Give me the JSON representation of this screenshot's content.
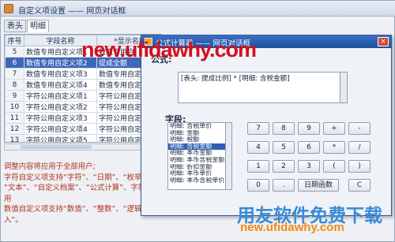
{
  "back_window": {
    "title": "自定义项设置 —— 网页对话框",
    "tabs": [
      "表头",
      "明细"
    ],
    "grid": {
      "headers": [
        "序号",
        "字段名称",
        "*显示名称"
      ],
      "rows": [
        {
          "no": "5",
          "field": "数值专用自定义项1",
          "display": "数值专用自"
        },
        {
          "no": "6",
          "field": "数值专用自定义项2",
          "display": "提成全额"
        },
        {
          "no": "7",
          "field": "数值专用自定义项3",
          "display": "数值专用自定..."
        },
        {
          "no": "8",
          "field": "数值专用自定义项4",
          "display": "数值专用自定..."
        },
        {
          "no": "9",
          "field": "字符公用自定义项1",
          "display": "字符公用自定..."
        },
        {
          "no": "10",
          "field": "字符公用自定义项2",
          "display": "字符公用自定..."
        },
        {
          "no": "11",
          "field": "字符公用自定义项3",
          "display": "字符公用自定..."
        },
        {
          "no": "12",
          "field": "字符公用自定义项4",
          "display": "字符公用自定..."
        },
        {
          "no": "13",
          "field": "字符公用自定义项5",
          "display": "字符公用自定..."
        }
      ]
    },
    "notes": [
      "调整内容将应用于全部用户;",
      "字符自定义项支持“字符”、“日期”、“枚举”、",
      "“文本”、“自定义档案”、“公式计算”、字符公用",
      "数值自定义项支持“数值”、“整数”、“逻辑”",
      "入”。"
    ]
  },
  "dialog": {
    "title": "公式计算器 —— 网页对话框",
    "close": "×",
    "formula_label": "公式:",
    "formula_value": "[表头: 提成比例] * [明细: 含税金额]",
    "field_label": "字段:",
    "fields": [
      "明细: 含税单价",
      "明细: 金额",
      "明细: 税额",
      "明细: 含税金额",
      "明细: 本币金额",
      "明细: 本币含税金额",
      "明细: 折扣金额",
      "明细: 本币单价",
      "明细: 本币含税单价"
    ],
    "selected_field": 3,
    "keypad": [
      "7",
      "8",
      "9",
      "+",
      "-",
      "4",
      "5",
      "6",
      "*",
      "/",
      "1",
      "2",
      "3",
      "(",
      ")",
      "0",
      ".",
      "日期函数",
      "C"
    ]
  },
  "watermarks": {
    "top": "new.ufidawhy.com",
    "bottom_cn": "用友软件免费下载",
    "bottom_url": "new.ufidawhy.com"
  }
}
